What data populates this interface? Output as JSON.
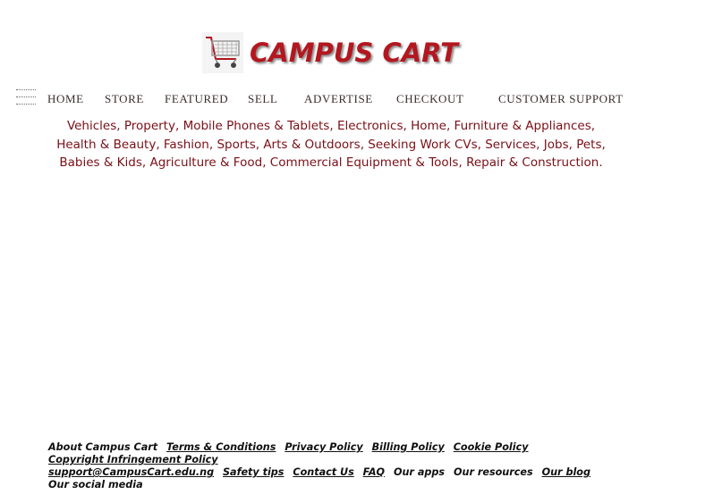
{
  "brand": {
    "name": "CAMPUS CART",
    "logo_icon": "shopping-cart-icon",
    "brand_color": "#b3171f"
  },
  "menu_icon": "hamburger-menu-icon",
  "nav": {
    "items": [
      {
        "label": "HOME"
      },
      {
        "label": "STORE"
      },
      {
        "label": "FEATURED"
      },
      {
        "label": "SELL"
      },
      {
        "label": "ADVERTISE"
      },
      {
        "label": "CHECKOUT"
      },
      {
        "label": "CUSTOMER SUPPORT"
      }
    ]
  },
  "categories": [
    "Vehicles",
    "Property",
    "Mobile Phones & Tablets",
    "Electronics",
    "Home, Furniture & Appliances",
    "Health & Beauty",
    "Fashion",
    "Sports, Arts & Outdoors",
    "Seeking Work CVs",
    "Services",
    "Jobs",
    "Pets",
    "Babies & Kids",
    "Agriculture & Food",
    "Commercial Equipment & Tools",
    "Repair & Construction"
  ],
  "category_color": "#7a0f17",
  "footer": {
    "links": [
      {
        "label": "About Campus Cart",
        "underline": false
      },
      {
        "label": "Terms & Conditions",
        "underline": true
      },
      {
        "label": "Privacy Policy",
        "underline": true
      },
      {
        "label": "Billing Policy",
        "underline": true
      },
      {
        "label": "Cookie Policy",
        "underline": true
      },
      {
        "label": "Copyright Infringement Policy",
        "underline": true
      },
      {
        "label": "support@CampusCart.edu.ng",
        "underline": true
      },
      {
        "label": "Safety tips",
        "underline": true
      },
      {
        "label": "Contact Us",
        "underline": true
      },
      {
        "label": "FAQ",
        "underline": true
      },
      {
        "label": "Our apps",
        "underline": false
      },
      {
        "label": "Our resources",
        "underline": false
      },
      {
        "label": "Our blog",
        "underline": true
      },
      {
        "label": "Our social media",
        "underline": false
      }
    ]
  }
}
